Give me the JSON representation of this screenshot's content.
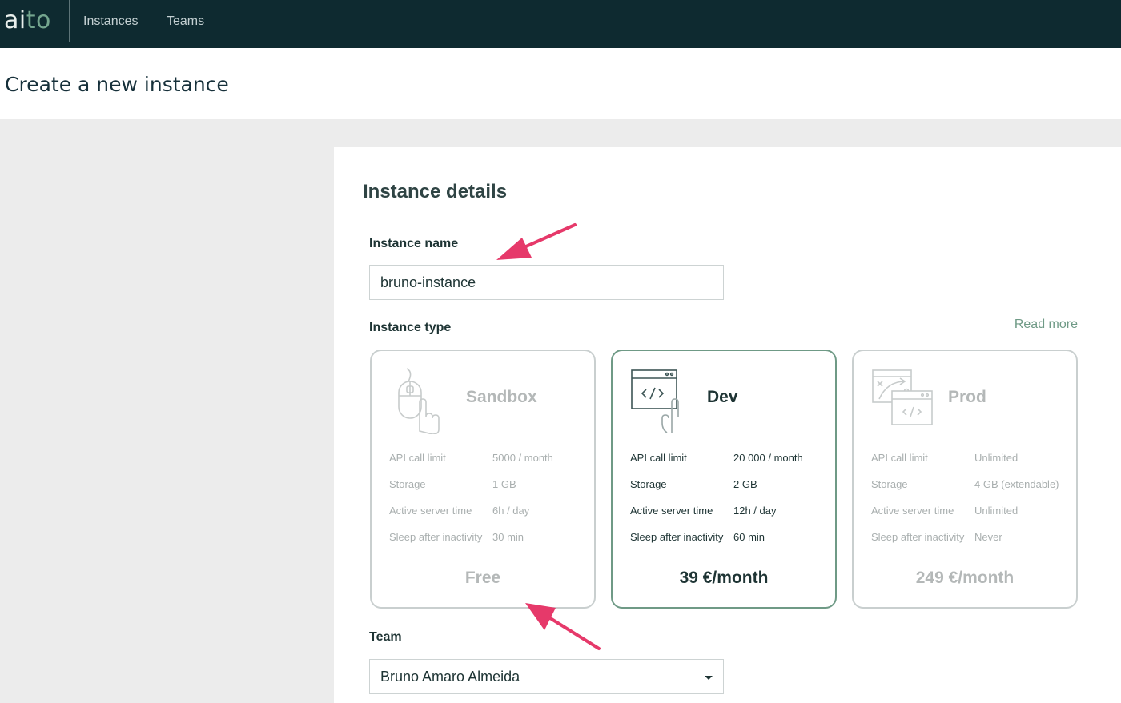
{
  "nav": {
    "logo_a": "ai",
    "logo_b": "to",
    "items": [
      "Instances",
      "Teams"
    ]
  },
  "page": {
    "title": "Create a new instance"
  },
  "form": {
    "section_title": "Instance details",
    "name_label": "Instance name",
    "name_value": "bruno-instance",
    "type_label": "Instance type",
    "read_more": "Read more",
    "team_label": "Team",
    "team_value": "Bruno Amaro Almeida"
  },
  "plans": [
    {
      "name": "Sandbox",
      "selected": false,
      "specs": [
        {
          "label": "API call limit",
          "value": "5000 / month"
        },
        {
          "label": "Storage",
          "value": "1 GB"
        },
        {
          "label": "Active server time",
          "value": "6h / day"
        },
        {
          "label": "Sleep after inactivity",
          "value": "30 min"
        }
      ],
      "price": "Free",
      "icon": "mouse-click-icon"
    },
    {
      "name": "Dev",
      "selected": true,
      "specs": [
        {
          "label": "API call limit",
          "value": "20 000 / month"
        },
        {
          "label": "Storage",
          "value": "2 GB"
        },
        {
          "label": "Active server time",
          "value": "12h / day"
        },
        {
          "label": "Sleep after inactivity",
          "value": "60 min"
        }
      ],
      "price": "39 €/month",
      "icon": "code-window-click-icon"
    },
    {
      "name": "Prod",
      "selected": false,
      "specs": [
        {
          "label": "API call limit",
          "value": "Unlimited"
        },
        {
          "label": "Storage",
          "value": "4 GB (extendable)"
        },
        {
          "label": "Active server time",
          "value": "Unlimited"
        },
        {
          "label": "Sleep after inactivity",
          "value": "Never"
        }
      ],
      "price": "249 €/month",
      "icon": "deploy-windows-icon"
    }
  ],
  "colors": {
    "topbar": "#0e2a30",
    "accent": "#6f9a86",
    "annotation_arrow": "#e6396a"
  }
}
